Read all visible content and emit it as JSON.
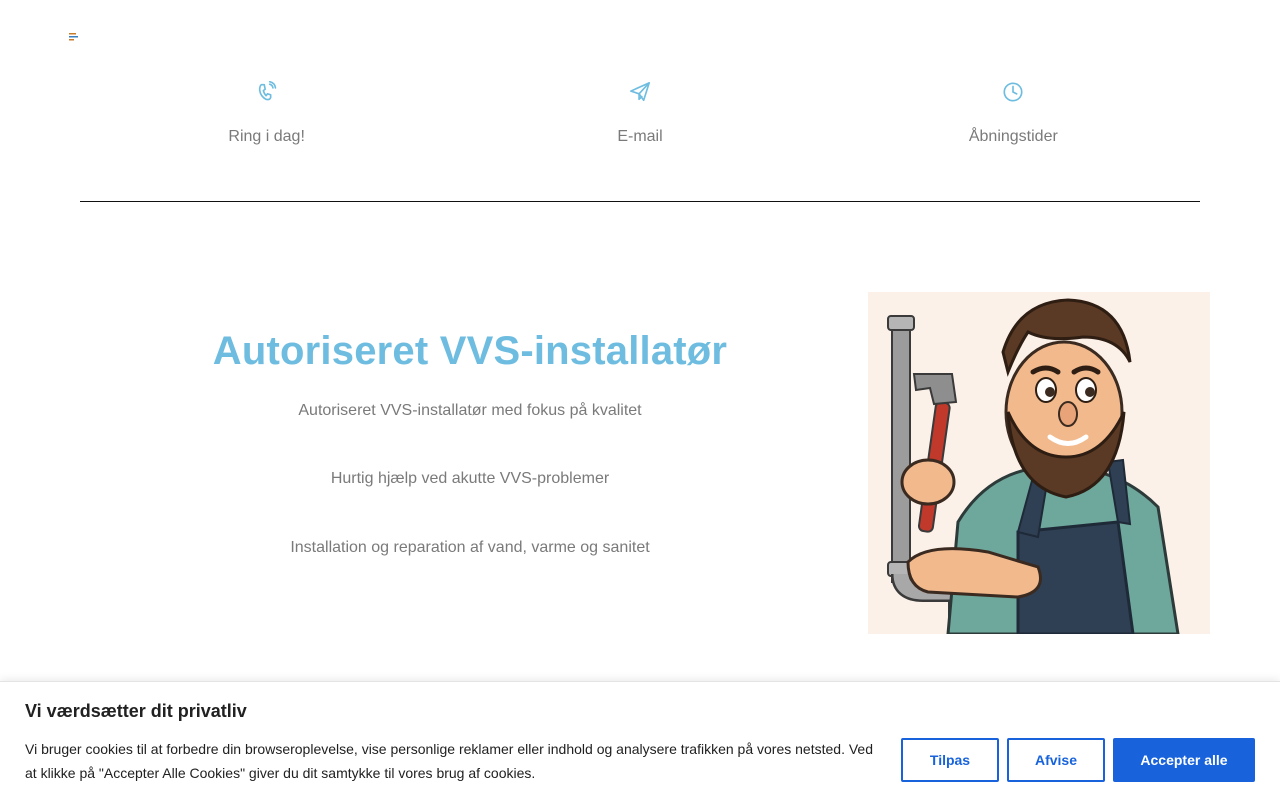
{
  "info": {
    "phone_label": "Ring i dag!",
    "email_label": "E-mail",
    "hours_label": "Åbningstider",
    "icon_color": "#6ebde0"
  },
  "hero": {
    "title": "Autoriseret VVS-installatør",
    "lines": [
      "Autoriseret VVS-installatør med fokus på kvalitet",
      "Hurtig hjælp ved akutte VVS-problemer",
      "Installation og reparation af vand, varme og sanitet"
    ],
    "title_color": "#6ebde0"
  },
  "cookie": {
    "title": "Vi værdsætter dit privatliv",
    "text": "Vi bruger cookies til at forbedre din browseroplevelse, vise personlige reklamer eller indhold og analysere trafikken på vores netsted. Ved at klikke på \"Accepter Alle Cookies\" giver du dit samtykke til vores brug af cookies.",
    "customize_label": "Tilpas",
    "reject_label": "Afvise",
    "accept_label": "Accepter alle",
    "accent_color": "#1863dc"
  }
}
